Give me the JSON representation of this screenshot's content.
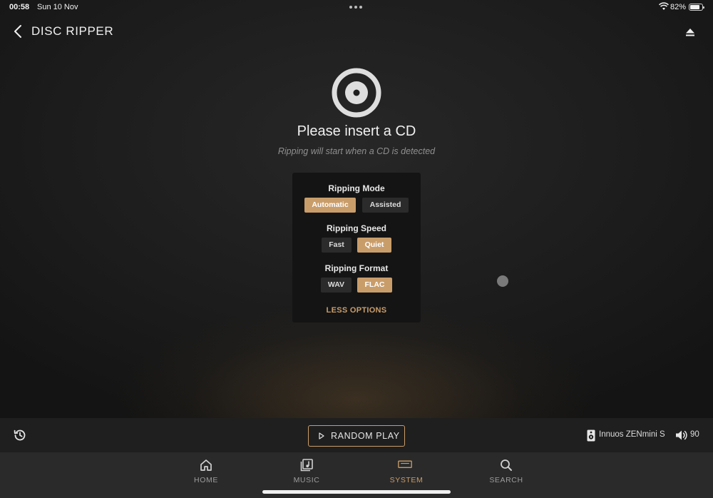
{
  "status_bar": {
    "time": "00:58",
    "date": "Sun 10 Nov",
    "battery_pct": "82%",
    "battery_level": 0.82
  },
  "header": {
    "title": "DISC RIPPER",
    "back_icon": "chevron-left-icon",
    "eject_icon": "eject-icon"
  },
  "main": {
    "icon": "cd-icon",
    "title": "Please insert a CD",
    "subtitle": "Ripping will start when a CD is detected"
  },
  "options": {
    "ripping_mode": {
      "label": "Ripping Mode",
      "buttons": [
        "Automatic",
        "Assisted"
      ],
      "selected": "Automatic"
    },
    "ripping_speed": {
      "label": "Ripping Speed",
      "buttons": [
        "Fast",
        "Quiet"
      ],
      "selected": "Quiet"
    },
    "ripping_format": {
      "label": "Ripping Format",
      "buttons": [
        "WAV",
        "FLAC"
      ],
      "selected": "FLAC"
    },
    "less_options": "LESS OPTIONS"
  },
  "player_bar": {
    "random_play": "RANDOM PLAY",
    "device_name": "Innuos ZENmini S",
    "volume": "90"
  },
  "tabs": [
    {
      "label": "HOME",
      "icon": "home-icon",
      "active": false
    },
    {
      "label": "MUSIC",
      "icon": "music-library-icon",
      "active": false
    },
    {
      "label": "SYSTEM",
      "icon": "system-device-icon",
      "active": true
    },
    {
      "label": "SEARCH",
      "icon": "search-icon",
      "active": false
    }
  ],
  "colors": {
    "accent": "#c99d6a",
    "background": "#1c1c1c",
    "panel": "#141414"
  }
}
